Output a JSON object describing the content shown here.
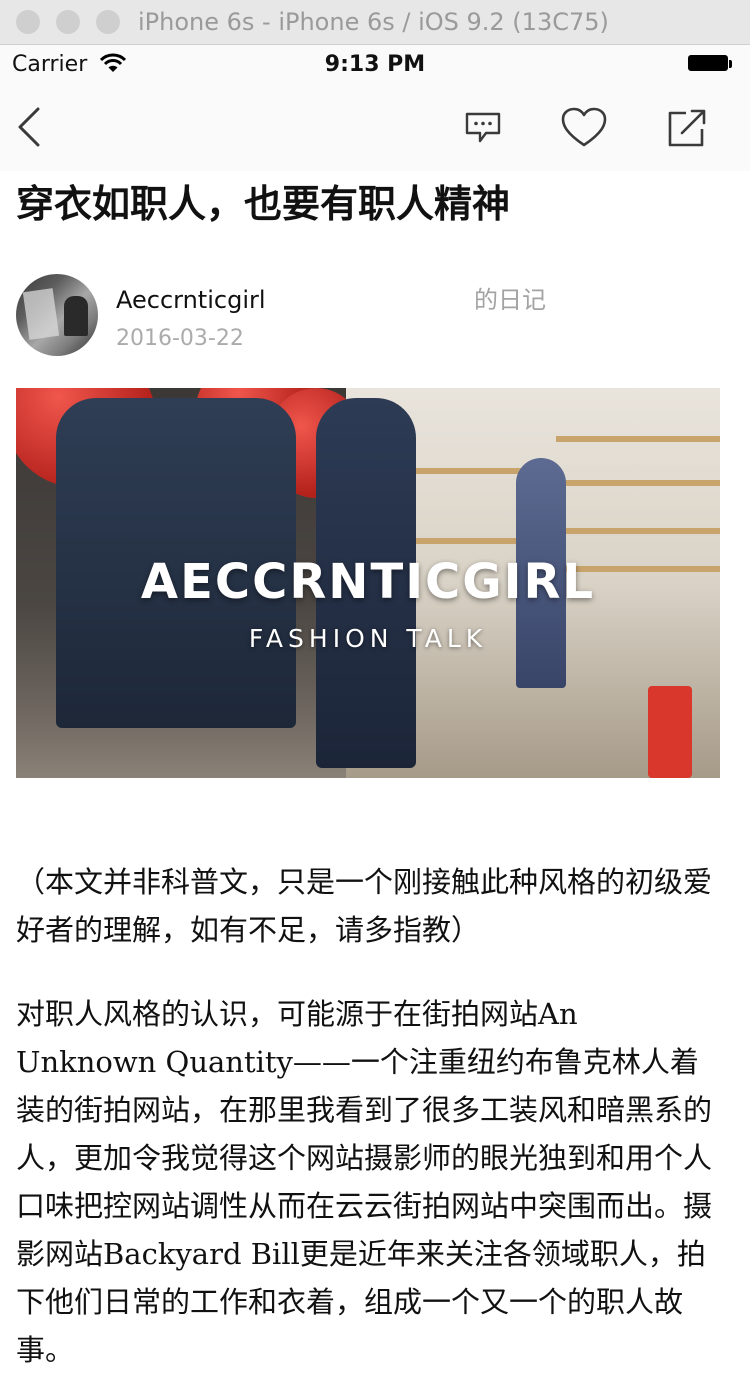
{
  "window": {
    "title": "iPhone 6s - iPhone 6s / iOS 9.2 (13C75)"
  },
  "status_bar": {
    "carrier": "Carrier",
    "time": "9:13 PM"
  },
  "nav": {
    "back_icon": "chevron-left-icon",
    "comment_icon": "comment-icon",
    "like_icon": "heart-icon",
    "share_icon": "share-icon"
  },
  "article": {
    "title": "穿衣如职人，也要有职人精神",
    "author": "Aeccrnticgirl",
    "author_suffix": "的日记",
    "date": "2016-03-22",
    "cover": {
      "headline": "AECCRNTICGIRL",
      "subhead": "FASHION TALK"
    },
    "paragraphs": [
      "（本文并非科普文，只是一个刚接触此种风格的初级爱好者的理解，如有不足，请多指教）",
      "对职人风格的认识，可能源于在街拍网站An Unknown Quantity——一个注重纽约布鲁克林人着装的街拍网站，在那里我看到了很多工装风和暗黑系的人，更加令我觉得这个网站摄影师的眼光独到和用个人口味把控网站调性从而在云云街拍网站中突围而出。摄影网站Backyard Bill更是近年来关注各领域职人，拍下他们日常的工作和衣着，组成一个又一个的职人故事。"
    ]
  },
  "colors": {
    "nav_bg": "#fafafa",
    "meta_gray": "#ababab",
    "icon_gray": "#3a3a3a"
  }
}
